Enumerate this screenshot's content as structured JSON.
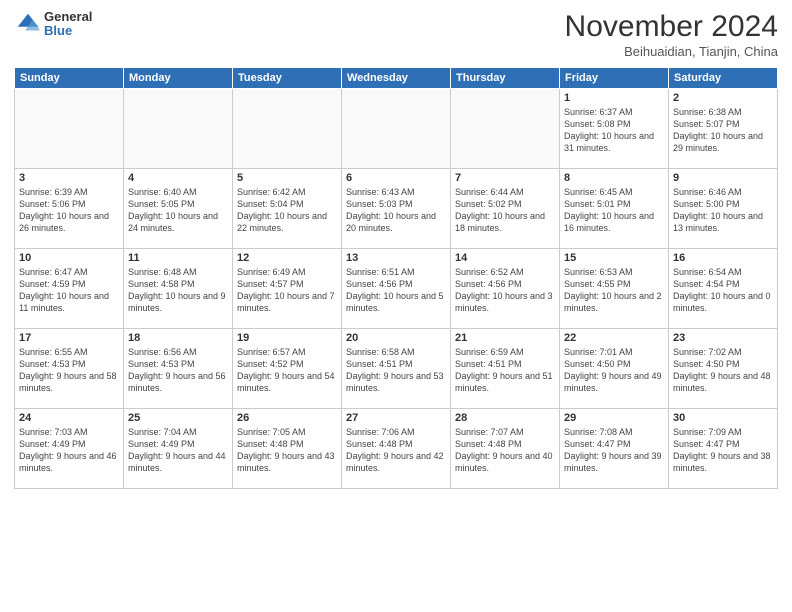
{
  "logo": {
    "general": "General",
    "blue": "Blue"
  },
  "header": {
    "month": "November 2024",
    "location": "Beihuaidian, Tianjin, China"
  },
  "days_of_week": [
    "Sunday",
    "Monday",
    "Tuesday",
    "Wednesday",
    "Thursday",
    "Friday",
    "Saturday"
  ],
  "weeks": [
    [
      {
        "day": "",
        "info": ""
      },
      {
        "day": "",
        "info": ""
      },
      {
        "day": "",
        "info": ""
      },
      {
        "day": "",
        "info": ""
      },
      {
        "day": "",
        "info": ""
      },
      {
        "day": "1",
        "info": "Sunrise: 6:37 AM\nSunset: 5:08 PM\nDaylight: 10 hours and 31 minutes."
      },
      {
        "day": "2",
        "info": "Sunrise: 6:38 AM\nSunset: 5:07 PM\nDaylight: 10 hours and 29 minutes."
      }
    ],
    [
      {
        "day": "3",
        "info": "Sunrise: 6:39 AM\nSunset: 5:06 PM\nDaylight: 10 hours and 26 minutes."
      },
      {
        "day": "4",
        "info": "Sunrise: 6:40 AM\nSunset: 5:05 PM\nDaylight: 10 hours and 24 minutes."
      },
      {
        "day": "5",
        "info": "Sunrise: 6:42 AM\nSunset: 5:04 PM\nDaylight: 10 hours and 22 minutes."
      },
      {
        "day": "6",
        "info": "Sunrise: 6:43 AM\nSunset: 5:03 PM\nDaylight: 10 hours and 20 minutes."
      },
      {
        "day": "7",
        "info": "Sunrise: 6:44 AM\nSunset: 5:02 PM\nDaylight: 10 hours and 18 minutes."
      },
      {
        "day": "8",
        "info": "Sunrise: 6:45 AM\nSunset: 5:01 PM\nDaylight: 10 hours and 16 minutes."
      },
      {
        "day": "9",
        "info": "Sunrise: 6:46 AM\nSunset: 5:00 PM\nDaylight: 10 hours and 13 minutes."
      }
    ],
    [
      {
        "day": "10",
        "info": "Sunrise: 6:47 AM\nSunset: 4:59 PM\nDaylight: 10 hours and 11 minutes."
      },
      {
        "day": "11",
        "info": "Sunrise: 6:48 AM\nSunset: 4:58 PM\nDaylight: 10 hours and 9 minutes."
      },
      {
        "day": "12",
        "info": "Sunrise: 6:49 AM\nSunset: 4:57 PM\nDaylight: 10 hours and 7 minutes."
      },
      {
        "day": "13",
        "info": "Sunrise: 6:51 AM\nSunset: 4:56 PM\nDaylight: 10 hours and 5 minutes."
      },
      {
        "day": "14",
        "info": "Sunrise: 6:52 AM\nSunset: 4:56 PM\nDaylight: 10 hours and 3 minutes."
      },
      {
        "day": "15",
        "info": "Sunrise: 6:53 AM\nSunset: 4:55 PM\nDaylight: 10 hours and 2 minutes."
      },
      {
        "day": "16",
        "info": "Sunrise: 6:54 AM\nSunset: 4:54 PM\nDaylight: 10 hours and 0 minutes."
      }
    ],
    [
      {
        "day": "17",
        "info": "Sunrise: 6:55 AM\nSunset: 4:53 PM\nDaylight: 9 hours and 58 minutes."
      },
      {
        "day": "18",
        "info": "Sunrise: 6:56 AM\nSunset: 4:53 PM\nDaylight: 9 hours and 56 minutes."
      },
      {
        "day": "19",
        "info": "Sunrise: 6:57 AM\nSunset: 4:52 PM\nDaylight: 9 hours and 54 minutes."
      },
      {
        "day": "20",
        "info": "Sunrise: 6:58 AM\nSunset: 4:51 PM\nDaylight: 9 hours and 53 minutes."
      },
      {
        "day": "21",
        "info": "Sunrise: 6:59 AM\nSunset: 4:51 PM\nDaylight: 9 hours and 51 minutes."
      },
      {
        "day": "22",
        "info": "Sunrise: 7:01 AM\nSunset: 4:50 PM\nDaylight: 9 hours and 49 minutes."
      },
      {
        "day": "23",
        "info": "Sunrise: 7:02 AM\nSunset: 4:50 PM\nDaylight: 9 hours and 48 minutes."
      }
    ],
    [
      {
        "day": "24",
        "info": "Sunrise: 7:03 AM\nSunset: 4:49 PM\nDaylight: 9 hours and 46 minutes."
      },
      {
        "day": "25",
        "info": "Sunrise: 7:04 AM\nSunset: 4:49 PM\nDaylight: 9 hours and 44 minutes."
      },
      {
        "day": "26",
        "info": "Sunrise: 7:05 AM\nSunset: 4:48 PM\nDaylight: 9 hours and 43 minutes."
      },
      {
        "day": "27",
        "info": "Sunrise: 7:06 AM\nSunset: 4:48 PM\nDaylight: 9 hours and 42 minutes."
      },
      {
        "day": "28",
        "info": "Sunrise: 7:07 AM\nSunset: 4:48 PM\nDaylight: 9 hours and 40 minutes."
      },
      {
        "day": "29",
        "info": "Sunrise: 7:08 AM\nSunset: 4:47 PM\nDaylight: 9 hours and 39 minutes."
      },
      {
        "day": "30",
        "info": "Sunrise: 7:09 AM\nSunset: 4:47 PM\nDaylight: 9 hours and 38 minutes."
      }
    ]
  ]
}
